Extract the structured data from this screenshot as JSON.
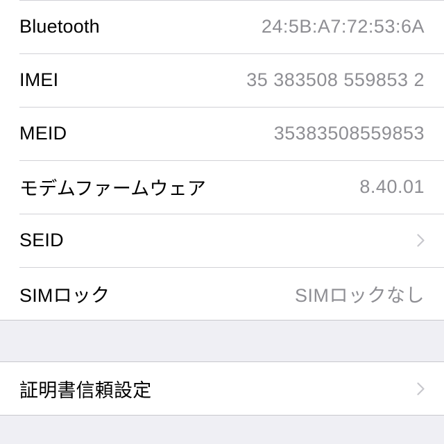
{
  "about_section": {
    "rows": [
      {
        "label": "Bluetooth",
        "value": "24:5B:A7:72:53:6A"
      },
      {
        "label": "IMEI",
        "value": "35 383508 559853 2"
      },
      {
        "label": "MEID",
        "value": "35383508559853"
      },
      {
        "label": "モデムファームウェア",
        "value": "8.40.01"
      },
      {
        "label": "SEID",
        "icon": "chevron-right-icon"
      },
      {
        "label": "SIMロック",
        "value": "SIMロックなし"
      }
    ]
  },
  "certificate_section": {
    "rows": [
      {
        "label": "証明書信頼設定",
        "icon": "chevron-right-icon"
      }
    ]
  },
  "colors": {
    "background": "#efeff4",
    "cell": "#ffffff",
    "label": "#000000",
    "value": "#8e8e93",
    "separator": "#c8c7cc",
    "chevron": "#c7c7cc"
  }
}
